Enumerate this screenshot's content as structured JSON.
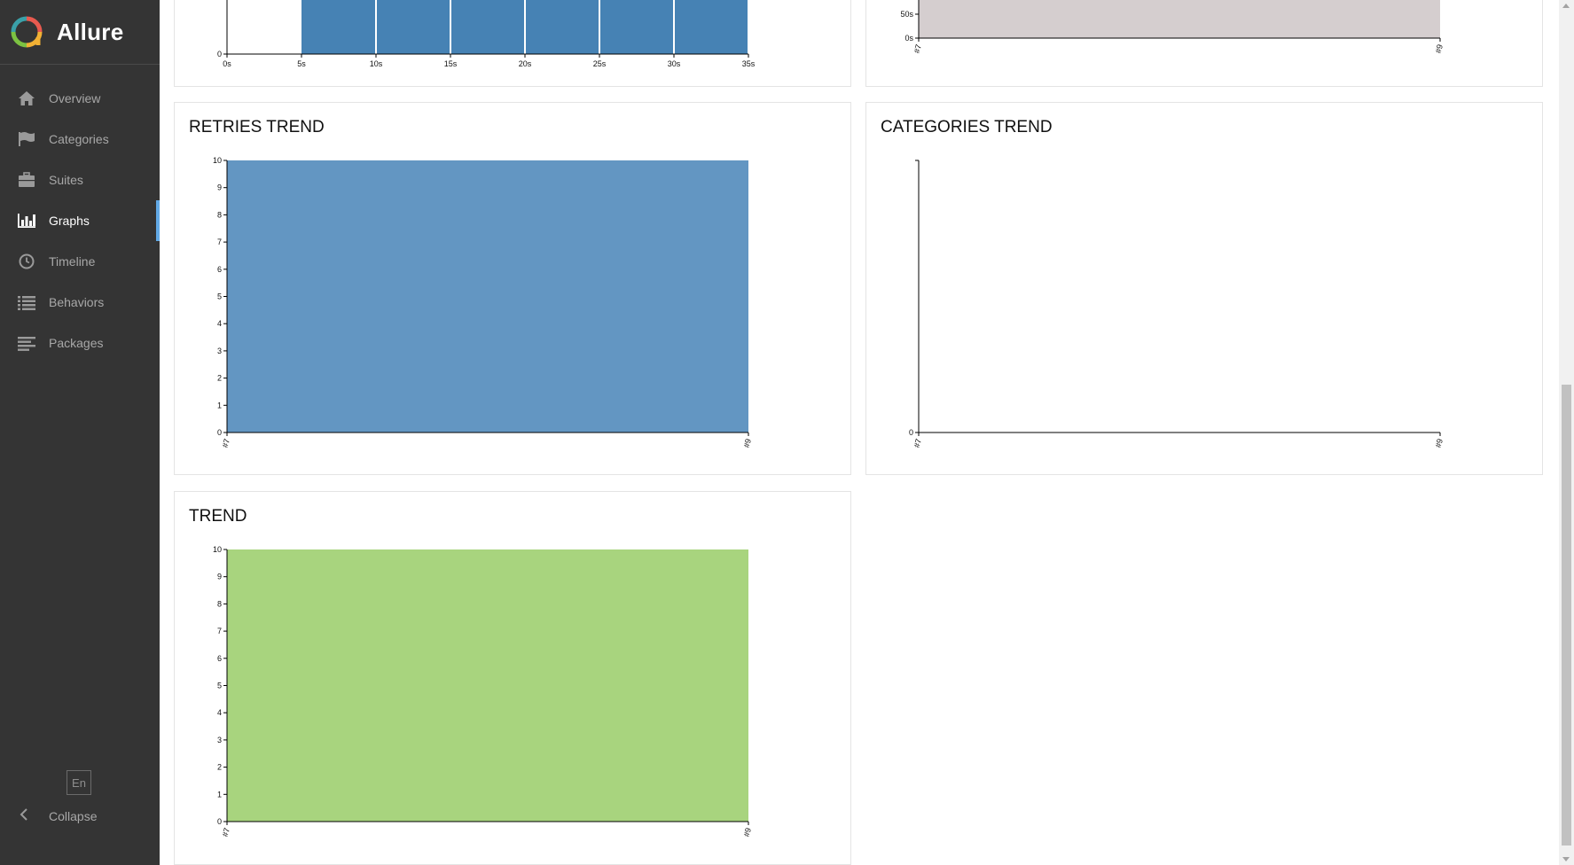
{
  "app": {
    "name": "Allure"
  },
  "sidebar": {
    "items": [
      {
        "label": "Overview",
        "icon": "home-icon",
        "active": false
      },
      {
        "label": "Categories",
        "icon": "flag-icon",
        "active": false
      },
      {
        "label": "Suites",
        "icon": "briefcase-icon",
        "active": false
      },
      {
        "label": "Graphs",
        "icon": "bar-chart-icon",
        "active": true
      },
      {
        "label": "Timeline",
        "icon": "clock-icon",
        "active": false
      },
      {
        "label": "Behaviors",
        "icon": "list-icon",
        "active": false
      },
      {
        "label": "Packages",
        "icon": "align-left-icon",
        "active": false
      }
    ],
    "language": "En",
    "collapse_label": "Collapse",
    "colors": {
      "background": "#343434",
      "active_indicator": "#62a9e6"
    }
  },
  "widgets": {
    "duration": {
      "title": ""
    },
    "duration_trend": {
      "title": ""
    },
    "retries_trend": {
      "title": "RETRIES TREND"
    },
    "categories_trend": {
      "title": "CATEGORIES TREND"
    },
    "trend": {
      "title": "TREND"
    }
  },
  "chart_data": [
    {
      "id": "duration",
      "type": "bar",
      "partially_visible": true,
      "x_ticks": [
        "0s",
        "5s",
        "10s",
        "15s",
        "20s",
        "25s",
        "30s",
        "35s"
      ],
      "xlim": [
        0,
        35
      ],
      "y_ticks_visible": [
        "0"
      ],
      "bins": [
        {
          "from": 0,
          "to": 5,
          "filled": false
        },
        {
          "from": 5,
          "to": 10,
          "filled": true
        },
        {
          "from": 10,
          "to": 15,
          "filled": true
        },
        {
          "from": 15,
          "to": 20,
          "filled": true
        },
        {
          "from": 20,
          "to": 25,
          "filled": true
        },
        {
          "from": 25,
          "to": 30,
          "filled": true
        },
        {
          "from": 30,
          "to": 35,
          "filled": true
        }
      ],
      "color": "#4682b4"
    },
    {
      "id": "duration_trend",
      "type": "area",
      "partially_visible": true,
      "categories": [
        "#7",
        "#9"
      ],
      "y_ticks_visible": [
        "50s",
        "0s"
      ],
      "color": "#d5cecf"
    },
    {
      "id": "retries_trend",
      "type": "area",
      "categories": [
        "#7",
        "#9"
      ],
      "ylim": [
        0,
        10
      ],
      "y_ticks": [
        "0",
        "1",
        "2",
        "3",
        "4",
        "5",
        "6",
        "7",
        "8",
        "9",
        "10"
      ],
      "series": [
        {
          "values": [
            10,
            10
          ]
        }
      ],
      "color": "#6396c2"
    },
    {
      "id": "categories_trend",
      "type": "area",
      "categories": [
        "#7",
        "#9"
      ],
      "y_ticks": [
        "0"
      ],
      "series": []
    },
    {
      "id": "trend",
      "type": "area",
      "categories": [
        "#7",
        "#9"
      ],
      "ylim": [
        0,
        10
      ],
      "y_ticks": [
        "0",
        "1",
        "2",
        "3",
        "4",
        "5",
        "6",
        "7",
        "8",
        "9",
        "10"
      ],
      "series": [
        {
          "values": [
            10,
            10
          ]
        }
      ],
      "color": "#a8d47e"
    }
  ]
}
